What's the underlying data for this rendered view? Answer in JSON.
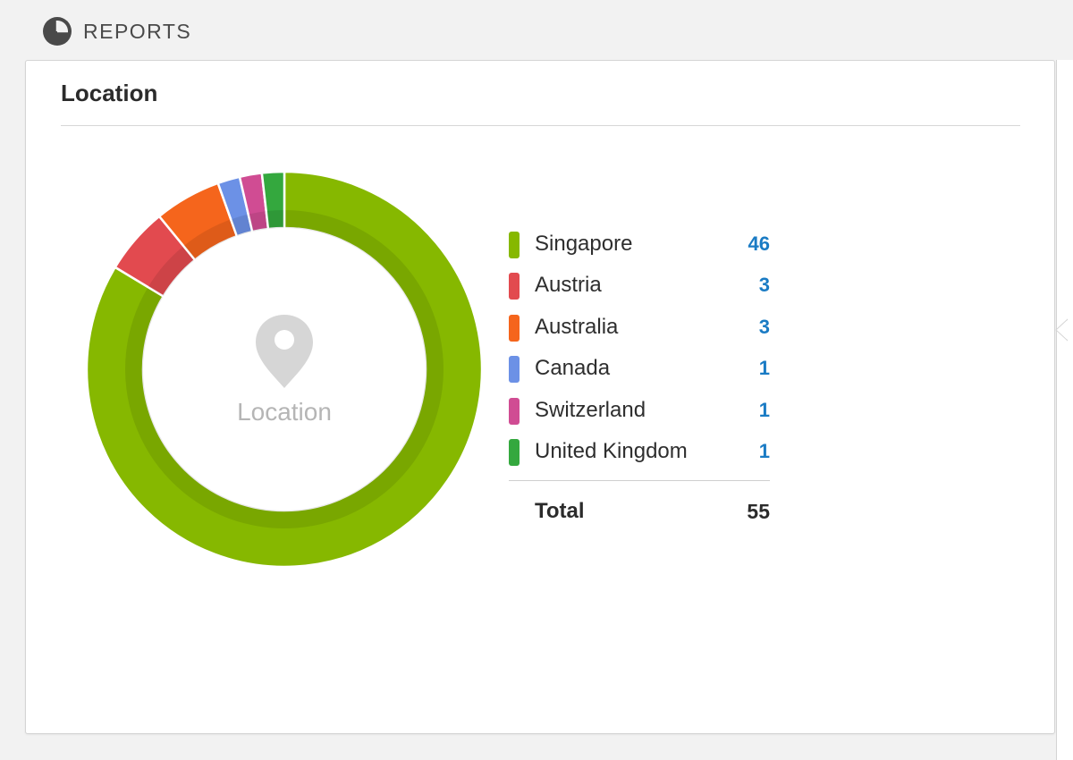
{
  "header": {
    "icon": "pie-chart-icon",
    "title": "REPORTS"
  },
  "card": {
    "title": "Location",
    "center_icon": "location-pin-icon",
    "center_label": "Location"
  },
  "colors": {
    "Singapore": "#86b800",
    "Austria": "#e24a4f",
    "Australia": "#f5651c",
    "Canada": "#6c91e6",
    "Switzerland": "#d04c93",
    "United Kingdom": "#34a83e",
    "value_text": "#1a7bc4",
    "center_gray": "#d6d6d6"
  },
  "chart_data": {
    "type": "pie",
    "variant": "donut",
    "title": "Location",
    "categories": [
      "Singapore",
      "Austria",
      "Australia",
      "Canada",
      "Switzerland",
      "United Kingdom"
    ],
    "values": [
      46,
      3,
      3,
      1,
      1,
      1
    ],
    "total_label": "Total",
    "total": 55,
    "legend_position": "right"
  }
}
